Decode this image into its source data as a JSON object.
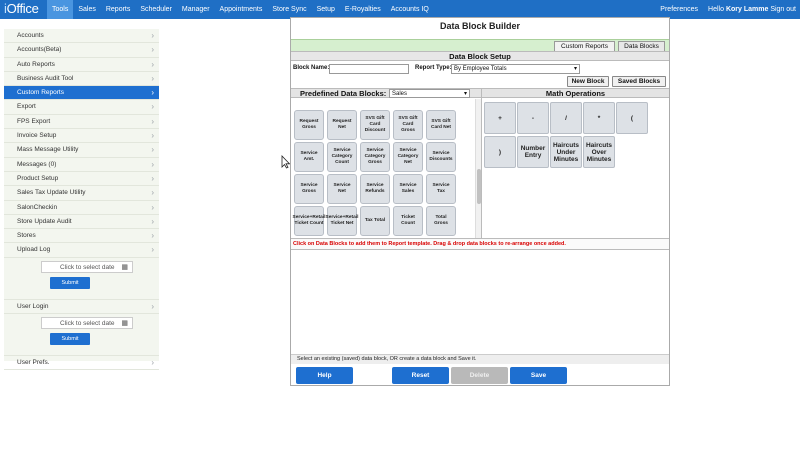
{
  "app": {
    "logo_prefix": "i",
    "logo_text": "Office"
  },
  "nav": {
    "items": [
      "Tools",
      "Sales",
      "Reports",
      "Scheduler",
      "Manager",
      "Appointments",
      "Store Sync",
      "Setup",
      "E-Royalties",
      "Accounts IQ"
    ],
    "active": "Tools"
  },
  "topright": {
    "preferences": "Preferences",
    "hello": "Hello",
    "user": "Kory Lamme",
    "signout": "Sign out"
  },
  "sidebar": {
    "items": [
      {
        "label": "Accounts"
      },
      {
        "label": "Accounts(Beta)"
      },
      {
        "label": "Auto Reports"
      },
      {
        "label": "Business Audit Tool"
      },
      {
        "label": "Custom Reports",
        "active": true
      },
      {
        "label": "Export"
      },
      {
        "label": "FPS Export"
      },
      {
        "label": "Invoice Setup"
      },
      {
        "label": "Mass Message Utility"
      },
      {
        "label": "Messages (0)"
      },
      {
        "label": "Product Setup"
      },
      {
        "label": "Sales Tax Update Utility"
      },
      {
        "label": "SalonCheckin"
      },
      {
        "label": "Store Update Audit"
      },
      {
        "label": "Stores"
      },
      {
        "label": "Upload Log"
      }
    ],
    "upload_log": {
      "date_placeholder": "Click to select date",
      "submit": "Submit"
    },
    "user_login": {
      "label": "User Login",
      "date_placeholder": "Click to select date",
      "submit": "Submit"
    },
    "user_prefs": "User Prefs."
  },
  "builder": {
    "title": "Data Block Builder",
    "tabs": [
      "Custom Reports",
      "Data Blocks"
    ],
    "active_tab": "Data Blocks",
    "setup_title": "Data Block Setup",
    "block_name_label": "Block Name:",
    "block_name_value": "",
    "report_type_label": "Report Type:",
    "report_type_value": "By Employee Totals",
    "new_block": "New Block",
    "saved_blocks": "Saved Blocks",
    "predefined_label": "Predefined Data Blocks:",
    "predefined_select": "Sales",
    "math_label": "Math Operations",
    "predefined_blocks": [
      "Request Gross",
      "Request Net",
      "SVS Gift Card Discount",
      "SVS Gift Card Gross",
      "SVS Gift Card Net",
      "Service Amt.",
      "Service Category Count",
      "Service Category Gross",
      "Service Category Net",
      "Service Discounts",
      "Service Gross",
      "Service Net",
      "Service Refunds",
      "Service Sales",
      "Service Tax",
      "Service+Retail Ticket Count",
      "Service+Retail Ticket Net",
      "Tax Total",
      "Ticket Count",
      "Total Gross"
    ],
    "math_ops": [
      "+",
      "-",
      "/",
      "*",
      "(",
      ")",
      "Number Entry",
      "Haircuts Under Minutes",
      "Haircuts Over Minutes"
    ],
    "instruction": "Click on Data Blocks to add them to Report template. Drag & drop data blocks to re-arrange once added.",
    "status": "Select an existing (saved) data block, OR create a data block and Save it.",
    "buttons": {
      "help": "Help",
      "reset": "Reset",
      "delete": "Delete",
      "save": "Save"
    }
  },
  "colors": {
    "nav": "#1f6fc5",
    "active": "#1e6fd0",
    "instruction": "#d80000"
  }
}
